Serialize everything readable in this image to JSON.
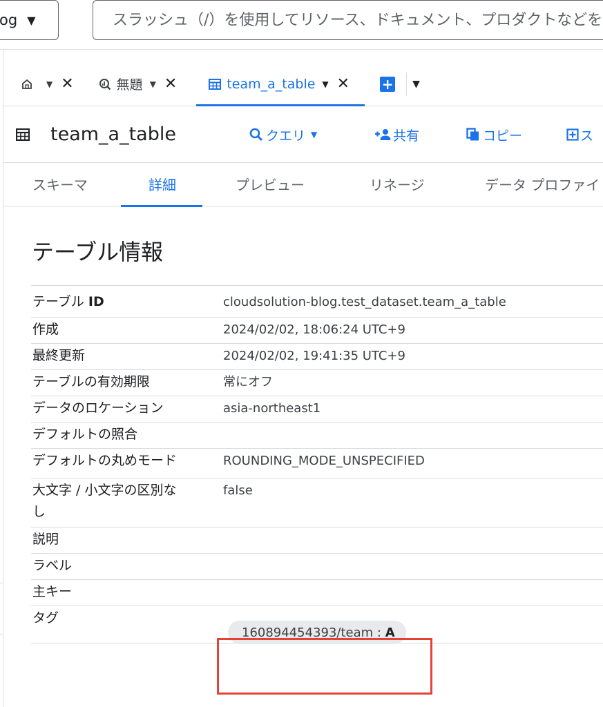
{
  "topbar": {
    "project_label": "og",
    "search_placeholder": "スラッシュ（/）を使用してリソース、ドキュメント、プロダクトなどを検索"
  },
  "tabs": {
    "home_icon": "home-icon",
    "untitled_label": "無題",
    "active_label": "team_a_table"
  },
  "resource": {
    "title": "team_a_table",
    "actions": {
      "query": "クエリ",
      "share": "共有",
      "copy": "コピー",
      "snapshot": "ス"
    }
  },
  "subtabs": {
    "schema": "スキーマ",
    "details": "詳細",
    "preview": "プレビュー",
    "lineage": "リネージ",
    "profile": "データ プロファイ"
  },
  "section_title": "テーブル情報",
  "table_info": {
    "table_id_label_prefix": "テーブル ",
    "table_id_label_bold": "ID",
    "table_id": "cloudsolution-blog.test_dataset.team_a_table",
    "created_label": "作成",
    "created": "2024/02/02, 18:06:24 UTC+9",
    "modified_label": "最終更新",
    "modified": "2024/02/02, 19:41:35 UTC+9",
    "expiration_label": "テーブルの有効期限",
    "expiration": "常にオフ",
    "location_label": "データのロケーション",
    "location": "asia-northeast1",
    "collation_label": "デフォルトの照合",
    "collation": "",
    "rounding_label": "デフォルトの丸めモード",
    "rounding": "ROUNDING_MODE_UNSPECIFIED",
    "case_label": "大文字 / 小文字の区別なし",
    "case": "false",
    "description_label": "説明",
    "description": "",
    "labels_label": "ラベル",
    "labels": "",
    "pk_label": "主キー",
    "pk": "",
    "tags_label": "タグ",
    "tag_key": "160894454393/team",
    "tag_sep": " : ",
    "tag_value": "A"
  },
  "colors": {
    "accent": "#1a73e8",
    "highlight": "#e34234"
  }
}
